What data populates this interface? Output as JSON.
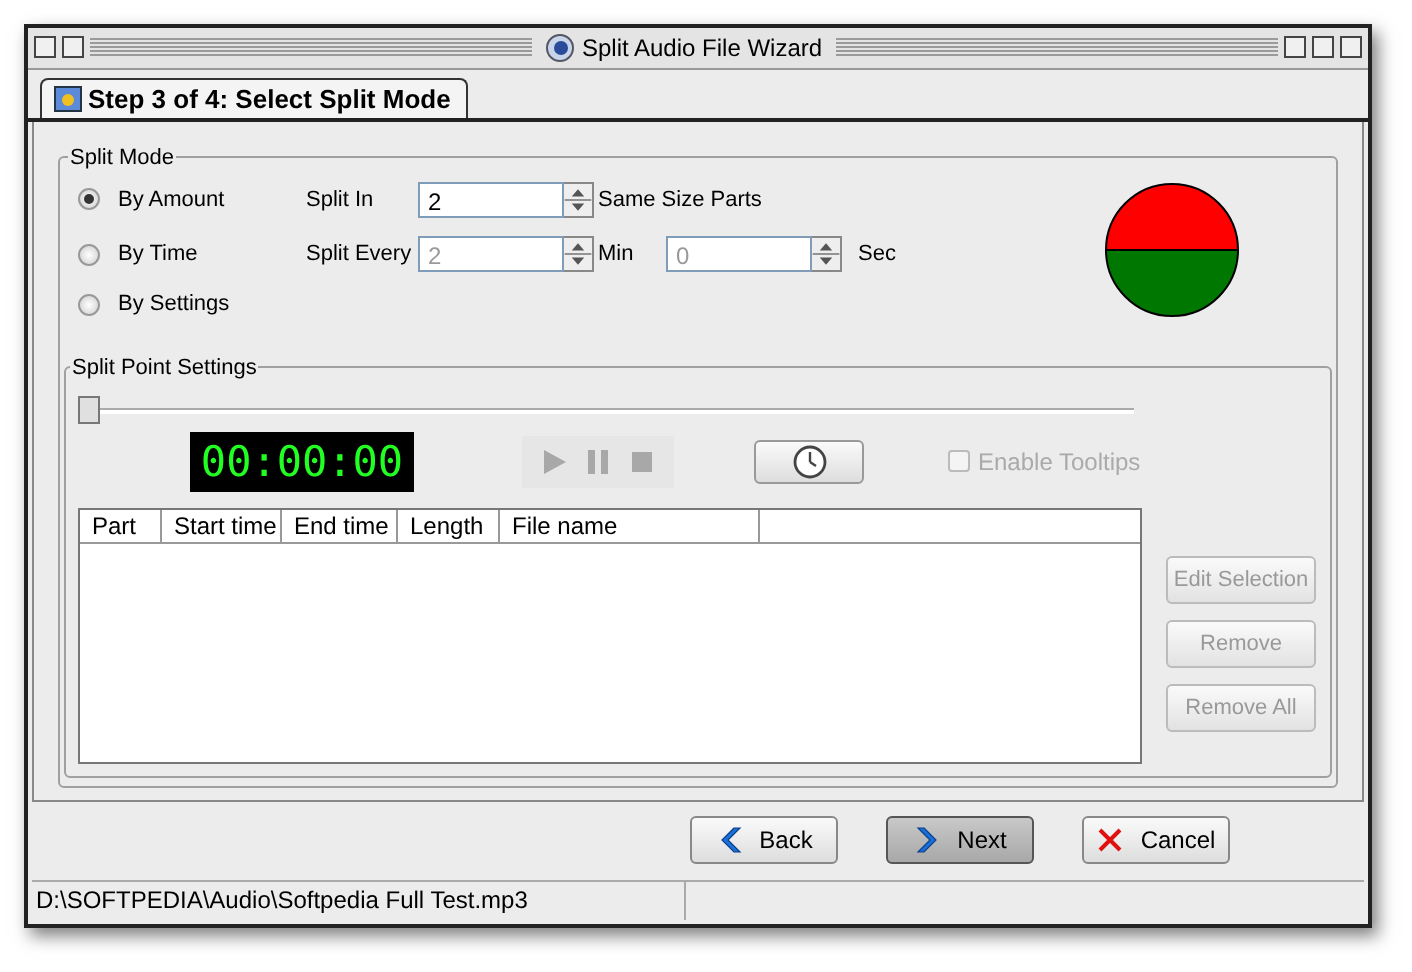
{
  "window": {
    "title": "Split Audio File Wizard"
  },
  "tab": {
    "label": "Step 3 of 4: Select Split Mode",
    "selected": true
  },
  "split_mode": {
    "title": "Split Mode",
    "options": [
      {
        "label": "By Amount",
        "selected": true
      },
      {
        "label": "By Time",
        "selected": false
      },
      {
        "label": "By Settings",
        "selected": false
      }
    ],
    "split_in": {
      "label": "Split In",
      "value": "2",
      "unit": "Same Size Parts",
      "disabled": false
    },
    "split_every": {
      "label": "Split Every",
      "value": "2",
      "unit": "Min",
      "disabled": true
    },
    "seconds": {
      "value": "0",
      "unit": "Sec",
      "disabled": true
    }
  },
  "split_point_settings": {
    "title": "Split Point Settings",
    "position": {
      "level": 0
    },
    "time_display": "00:00:00",
    "transport": [
      {
        "kind": "play",
        "disabled": true
      },
      {
        "kind": "pause",
        "disabled": true
      },
      {
        "kind": "stop",
        "disabled": true
      }
    ],
    "enable_tooltips": {
      "label": "Enable Tooltips",
      "checked": false,
      "disabled": true
    },
    "table": {
      "columns": [
        "Part",
        "Start time",
        "End time",
        "Length",
        "File name"
      ]
    },
    "buttons": [
      {
        "label": "Edit Selection",
        "disabled": true
      },
      {
        "label": "Remove",
        "disabled": true
      },
      {
        "label": "Remove All",
        "disabled": true
      }
    ]
  },
  "footer_buttons": [
    {
      "label": "Back",
      "kind": "back",
      "focused": false
    },
    {
      "label": "Next",
      "kind": "next",
      "focused": true
    },
    {
      "label": "Cancel",
      "kind": "cancel",
      "focused": false
    }
  ],
  "status_bar": [
    "D:\\SOFTPEDIA\\Audio\\Softpedia Full Test.mp3"
  ]
}
